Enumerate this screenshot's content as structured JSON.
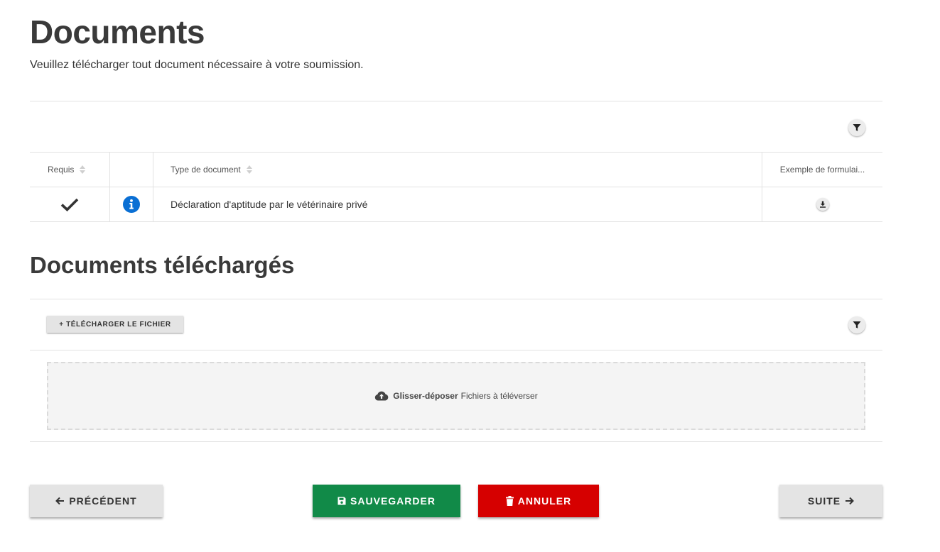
{
  "header": {
    "title": "Documents",
    "subtitle": "Veuillez télécharger tout document nécessaire à votre soumission."
  },
  "required_docs_table": {
    "columns": [
      "Requis",
      "",
      "Type de document",
      "Exemple de formulai..."
    ],
    "rows": [
      {
        "required_icon": "check-icon",
        "info_icon": "info-icon",
        "type": "Déclaration d'aptitude par le vétérinaire privé",
        "example_icon": "download-icon"
      }
    ]
  },
  "uploaded_section": {
    "title": "Documents téléchargés",
    "upload_button": "+ TÉLÉCHARGER LE FICHIER",
    "dropzone_bold": "Glisser-déposer",
    "dropzone_text": "Fichiers à téléverser"
  },
  "footer": {
    "previous": "PRÉCÉDENT",
    "save": "SAUVEGARDER",
    "cancel": "ANNULER",
    "next": "SUITE"
  },
  "colors": {
    "info": "#0a6fd4",
    "save": "#118a48",
    "cancel": "#d60000",
    "neutral_button": "#e4e4e4"
  }
}
